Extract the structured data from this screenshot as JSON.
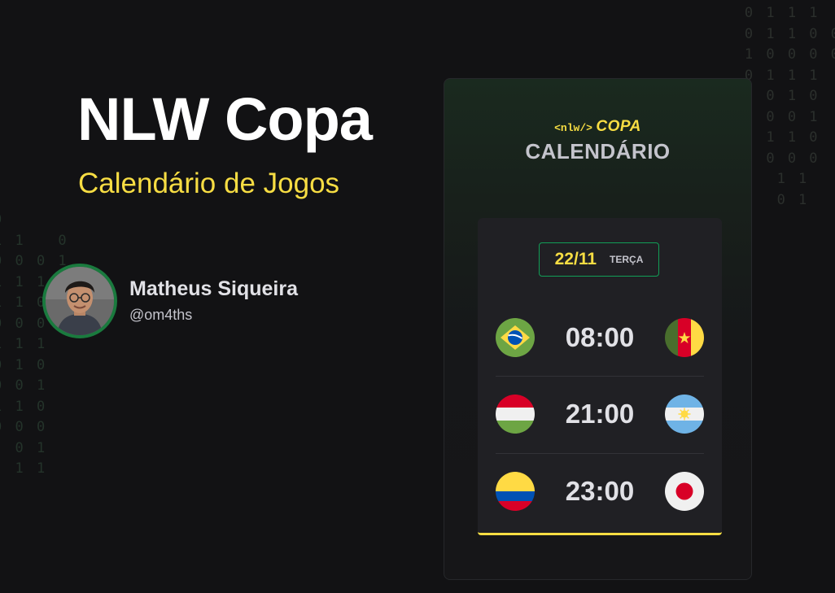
{
  "header": {
    "title": "NLW Copa",
    "subtitle": "Calendário de Jogos"
  },
  "author": {
    "name": "Matheus Siqueira",
    "handle": "@om4ths"
  },
  "app": {
    "brand_tag": "<nlw/>",
    "brand_name": "COPA",
    "screen_title": "CALENDÁRIO",
    "date": {
      "day": "22/11",
      "weekday": "TERÇA"
    },
    "games": [
      {
        "time": "08:00",
        "home_flag": "brazil-flag",
        "away_flag": "cameroon-flag"
      },
      {
        "time": "21:00",
        "home_flag": "hungary-flag",
        "away_flag": "argentina-flag"
      },
      {
        "time": "23:00",
        "home_flag": "colombia-flag",
        "away_flag": "japan-flag"
      }
    ]
  },
  "colors": {
    "background": "#121214",
    "accent_yellow": "#f7dd43",
    "accent_green": "#129e57",
    "card": "#202024"
  },
  "decor": {
    "binary_right": "0 1 1 1\n0 1 1 0 0\n1 0 0 0 0\n0 1 1 1\n1 0 1 0\n1 0 0 1\n  1 1 0\n  0 0 0\n   1 1\n   0 1",
    "binary_left": "0\n1 1   0\n0 0 0 1\n1 1 1\n1 1 0\n0 0 0\n1 1 1\n0 1 0\n0 0 1\n1 1 0\n0 0 0\n  0 1\n  1 1"
  }
}
